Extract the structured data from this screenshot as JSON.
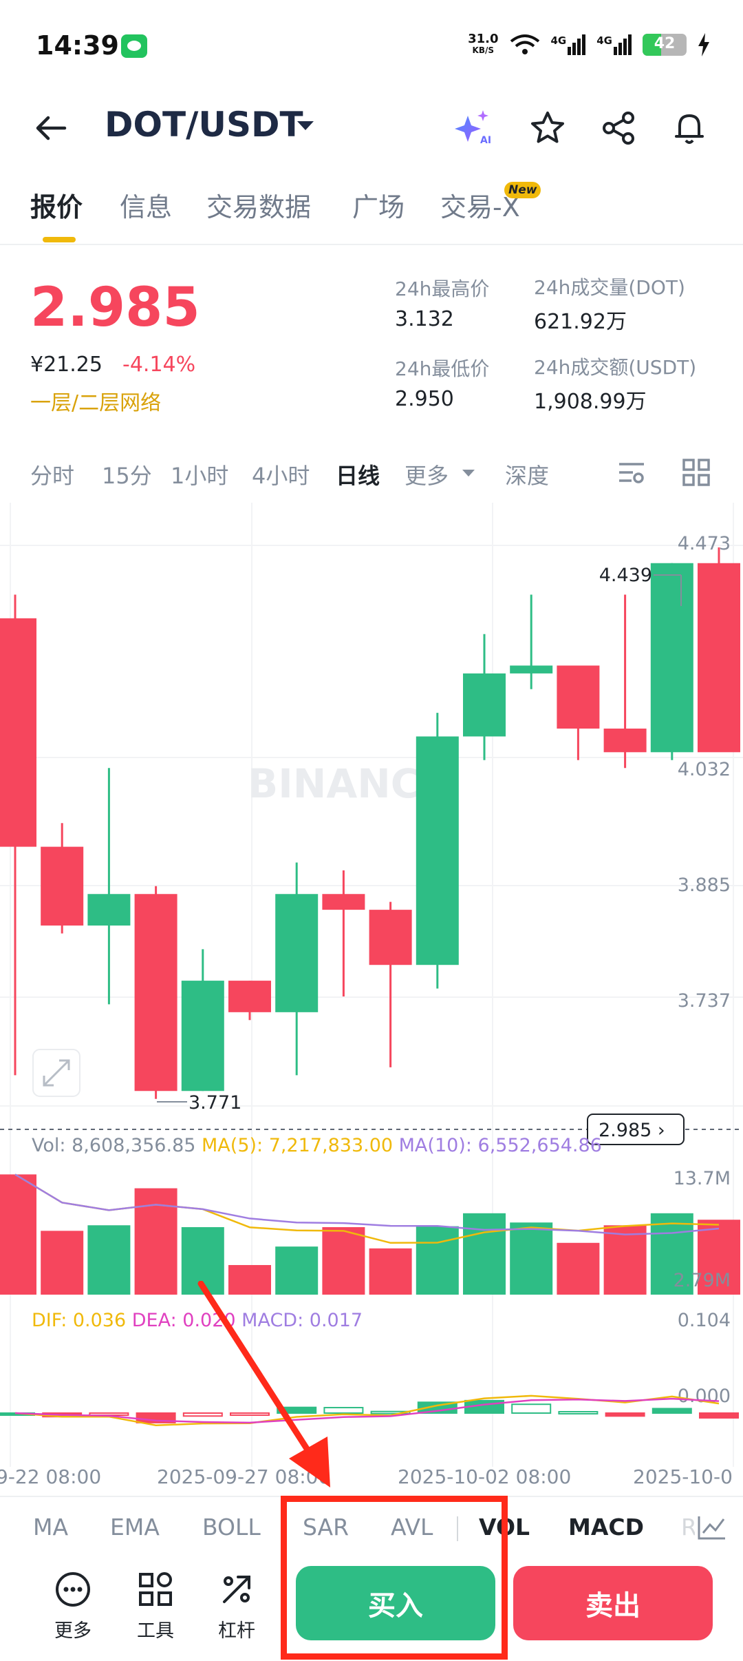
{
  "status_bar": {
    "time": "14:39",
    "net_speed_value": "31.0",
    "net_speed_unit": "KB/S",
    "signal_1": "4G",
    "signal_2": "4G",
    "battery": "42"
  },
  "header": {
    "pair": "DOT/USDT"
  },
  "tabs": [
    {
      "label": "报价"
    },
    {
      "label": "信息"
    },
    {
      "label": "交易数据"
    },
    {
      "label": "广场"
    },
    {
      "label": "交易-X"
    }
  ],
  "new_badge": "New",
  "price": {
    "last": "2.985",
    "cny": "¥21.25",
    "change": "-4.14%",
    "network": "一层/二层网络"
  },
  "stats": {
    "high_label": "24h最高价",
    "high": "3.132",
    "low_label": "24h最低价",
    "low": "2.950",
    "vol_label": "24h成交量(DOT)",
    "vol": "621.92万",
    "amt_label": "24h成交额(USDT)",
    "amt": "1,908.99万"
  },
  "intervals": [
    "分时",
    "15分",
    "1小时",
    "4小时",
    "日线",
    "更多",
    "深度"
  ],
  "chart_data": {
    "type": "candlestick",
    "watermark": "BINANC",
    "y_ticks": [
      "4.473",
      "4.032",
      "3.885",
      "3.737"
    ],
    "high_marker": "4.439",
    "low_marker": "3.771",
    "last_price_tag": "2.985",
    "vol_label": "Vol: 8,608,356.85",
    "vol_ma5": "MA(5): 7,217,833.00",
    "vol_ma10": "MA(10): 6,552,654.86",
    "vol_ticks": [
      "13.7M",
      "2.79M"
    ],
    "macd_dif": "DIF: 0.036",
    "macd_dea": "DEA: 0.020",
    "macd_val": "MACD: 0.017",
    "macd_ticks": [
      "0.104",
      "0.000"
    ],
    "x_labels": [
      "9-22 08:00",
      "2025-09-27 08:00",
      "2025-10-02 08:00",
      "2025-10-0"
    ],
    "colors": {
      "up": "#2ebd85",
      "down": "#f6465d",
      "ma5": "#f0b90b",
      "ma10": "#9f7de1",
      "dea": "#e040c0"
    },
    "candles": [
      {
        "o": 4.37,
        "h": 4.4,
        "l": 3.79,
        "c": 4.08
      },
      {
        "o": 4.08,
        "h": 4.11,
        "l": 3.97,
        "c": 3.98
      },
      {
        "o": 3.98,
        "h": 4.18,
        "l": 3.88,
        "c": 4.02
      },
      {
        "o": 4.02,
        "h": 4.03,
        "l": 3.76,
        "c": 3.77
      },
      {
        "o": 3.77,
        "h": 3.95,
        "l": 3.77,
        "c": 3.91
      },
      {
        "o": 3.91,
        "h": 3.91,
        "l": 3.86,
        "c": 3.87
      },
      {
        "o": 3.87,
        "h": 4.06,
        "l": 3.79,
        "c": 4.02
      },
      {
        "o": 4.02,
        "h": 4.05,
        "l": 3.89,
        "c": 4.0
      },
      {
        "o": 4.0,
        "h": 4.01,
        "l": 3.8,
        "c": 3.93
      },
      {
        "o": 3.93,
        "h": 4.25,
        "l": 3.9,
        "c": 4.22
      },
      {
        "o": 4.22,
        "h": 4.35,
        "l": 4.19,
        "c": 4.3
      },
      {
        "o": 4.3,
        "h": 4.4,
        "l": 4.28,
        "c": 4.31
      },
      {
        "o": 4.31,
        "h": 4.31,
        "l": 4.19,
        "c": 4.23
      },
      {
        "o": 4.23,
        "h": 4.4,
        "l": 4.18,
        "c": 4.2
      },
      {
        "o": 4.2,
        "h": 4.44,
        "l": 4.19,
        "c": 4.44
      },
      {
        "o": 4.44,
        "h": 4.46,
        "l": 4.21,
        "c": 4.2
      }
    ],
    "volumes": [
      13.0,
      6.9,
      7.5,
      11.5,
      7.3,
      3.2,
      5.2,
      7.3,
      5.0,
      7.4,
      8.8,
      7.8,
      5.6,
      7.5,
      8.8,
      8.1
    ]
  },
  "indicator_tabs": [
    "MA",
    "EMA",
    "BOLL",
    "SAR",
    "AVL",
    "VOL",
    "MACD",
    "R"
  ],
  "tools": [
    {
      "label": "更多"
    },
    {
      "label": "工具"
    },
    {
      "label": "杠杆"
    }
  ],
  "actions": {
    "buy": "买入",
    "sell": "卖出"
  }
}
